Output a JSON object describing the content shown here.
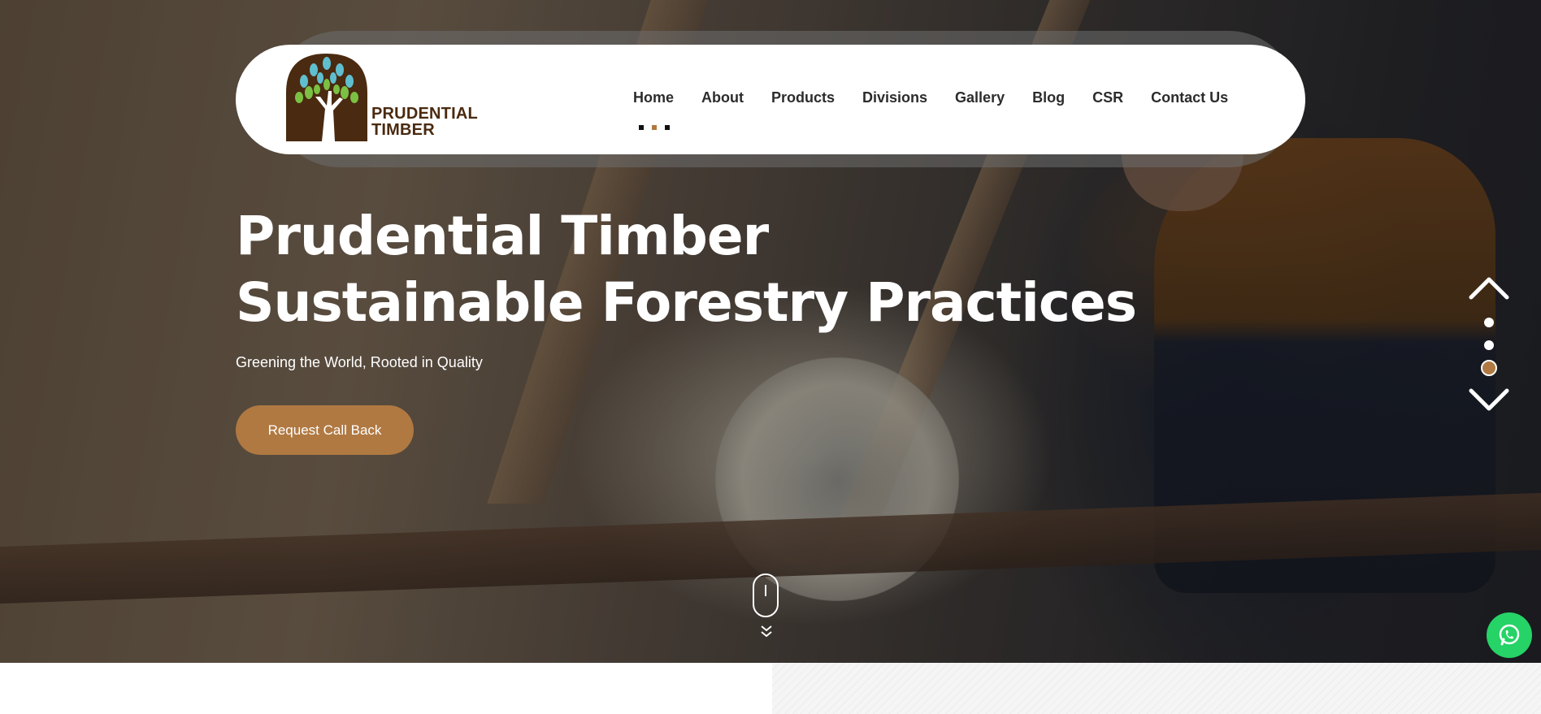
{
  "brand": {
    "line1": "PRUDENTIAL",
    "line2": "TIMBER"
  },
  "nav": {
    "items": [
      {
        "label": "Home"
      },
      {
        "label": "About"
      },
      {
        "label": "Products"
      },
      {
        "label": "Divisions"
      },
      {
        "label": "Gallery"
      },
      {
        "label": "Blog"
      },
      {
        "label": "CSR"
      },
      {
        "label": "Contact Us"
      }
    ],
    "active": "Home"
  },
  "hero": {
    "title_line1": "Prudential Timber",
    "title_line2": "Sustainable Forestry Practices",
    "tagline": "Greening the World, Rooted in Quality",
    "cta_label": "Request Call Back"
  },
  "slider": {
    "total": 3,
    "active": 3
  },
  "colors": {
    "accent": "#b07942",
    "brand_dark": "#4a2a10",
    "whatsapp": "#25d366"
  },
  "icons": {
    "up": "chevron-up-icon",
    "down": "chevron-down-icon",
    "scroll": "mouse-scroll-icon",
    "chat": "whatsapp-icon"
  }
}
